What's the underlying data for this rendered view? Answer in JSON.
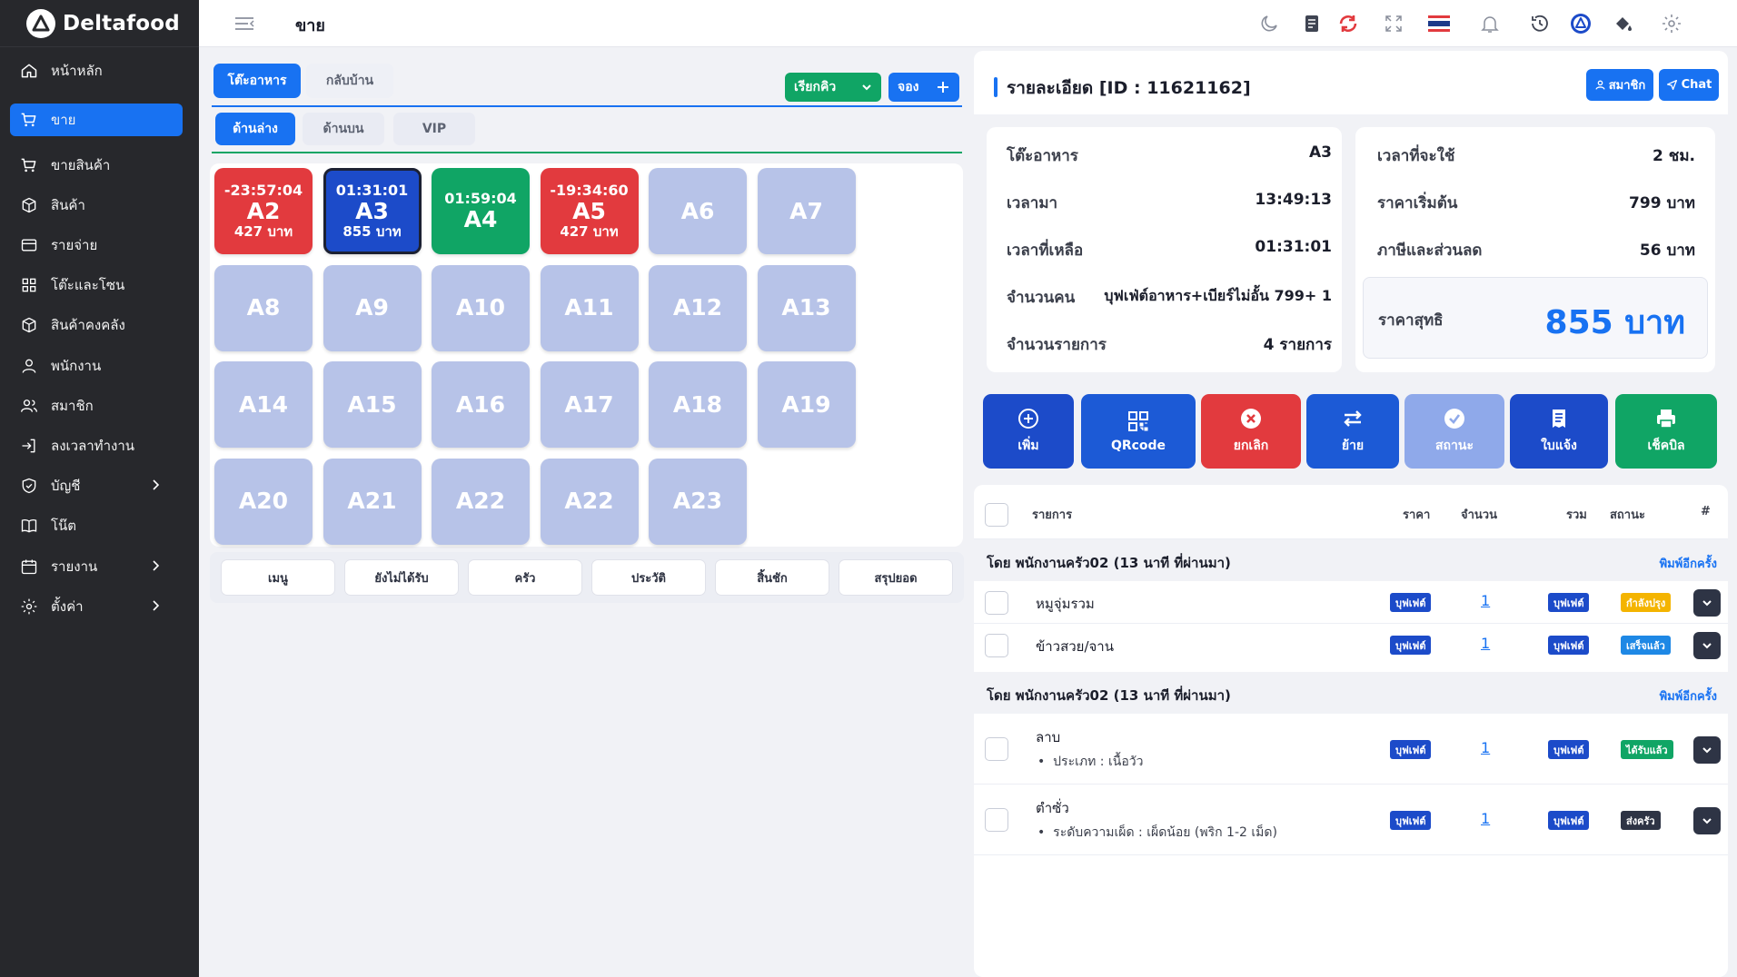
{
  "brand": {
    "name": "Deltafood"
  },
  "sidebar": {
    "items": [
      {
        "label": "หน้าหลัก",
        "icon": "home-icon"
      },
      {
        "label": "ขาย",
        "icon": "cart-icon",
        "active": true
      },
      {
        "label": "ขายสินค้า",
        "icon": "cart-icon"
      },
      {
        "label": "สินค้า",
        "icon": "box-icon"
      },
      {
        "label": "รายจ่าย",
        "icon": "card-icon"
      },
      {
        "label": "โต๊ะและโซน",
        "icon": "grid-icon"
      },
      {
        "label": "สินค้าคงคลัง",
        "icon": "box-icon"
      },
      {
        "label": "พนักงาน",
        "icon": "user-icon"
      },
      {
        "label": "สมาชิก",
        "icon": "users-icon"
      },
      {
        "label": "ลงเวลาทำงาน",
        "icon": "login-icon"
      },
      {
        "label": "บัญชี",
        "icon": "shield-icon",
        "submenu": true
      },
      {
        "label": "โน๊ต",
        "icon": "book-icon"
      },
      {
        "label": "รายงาน",
        "icon": "calendar-icon",
        "submenu": true
      },
      {
        "label": "ตั้งค่า",
        "icon": "gear-icon",
        "submenu": true
      }
    ]
  },
  "topbar": {
    "title": "ขาย"
  },
  "left": {
    "main_tabs": [
      {
        "label": "โต๊ะอาหาร",
        "active": true
      },
      {
        "label": "กลับบ้าน"
      }
    ],
    "queue_button": "เรียกคิว",
    "reserve_button": "จอง",
    "zone_tabs": [
      {
        "label": "ด้านล่าง",
        "active": true
      },
      {
        "label": "ด้านบน"
      },
      {
        "label": "VIP"
      }
    ],
    "tables": [
      {
        "name": "A2",
        "time": "-23:57:04",
        "price": "427 บาท",
        "status": "red"
      },
      {
        "name": "A3",
        "time": "01:31:01",
        "price": "855 บาท",
        "status": "blue"
      },
      {
        "name": "A4",
        "time": "01:59:04",
        "price": "",
        "status": "green"
      },
      {
        "name": "A5",
        "time": "-19:34:60",
        "price": "427 บาท",
        "status": "red"
      },
      {
        "name": "A6"
      },
      {
        "name": "A7"
      },
      {
        "name": "A8"
      },
      {
        "name": "A9"
      },
      {
        "name": "A10"
      },
      {
        "name": "A11"
      },
      {
        "name": "A12"
      },
      {
        "name": "A13"
      },
      {
        "name": "A14"
      },
      {
        "name": "A15"
      },
      {
        "name": "A16"
      },
      {
        "name": "A17"
      },
      {
        "name": "A18"
      },
      {
        "name": "A19"
      },
      {
        "name": "A20"
      },
      {
        "name": "A21"
      },
      {
        "name": "A22"
      },
      {
        "name": "A22"
      },
      {
        "name": "A23"
      }
    ],
    "bottom_tabs": [
      "เมนู",
      "ยังไม่ได้รับ",
      "ครัว",
      "ประวัติ",
      "สิ้นชัก",
      "สรุปยอด"
    ]
  },
  "detail": {
    "title": "รายละเอียด [ID : 11621162]",
    "member_button": "สมาชิก",
    "chat_button": "Chat",
    "info_left": [
      {
        "key": "โต๊ะอาหาร",
        "value": "A3"
      },
      {
        "key": "เวลามา",
        "value": "13:49:13"
      },
      {
        "key": "เวลาที่เหลือ",
        "value": "01:31:01"
      },
      {
        "key": "จำนวนคน",
        "value": "บุฟเฟ่ต์อาหาร+เบียร์ไม่อั้น 799+ 1"
      },
      {
        "key": "จำนวนรายการ",
        "value": "4 รายการ"
      }
    ],
    "info_right": [
      {
        "key": "เวลาที่จะใช้",
        "value": "2 ชม."
      },
      {
        "key": "ราคาเริ่มต้น",
        "value": "799 บาท"
      },
      {
        "key": "ภาษีและส่วนลด",
        "value": "56 บาท"
      }
    ],
    "net_label": "ราคาสุทธิ",
    "net_value": "855 บาท",
    "actions": [
      {
        "label": "เพิ่ม",
        "icon": "plus-circle-icon",
        "color": "#1c4bc9"
      },
      {
        "label": "QRcode",
        "icon": "qrcode-icon",
        "color": "#1c5ad6"
      },
      {
        "label": "ยกเลิก",
        "icon": "x-circle-icon",
        "color": "#e23a3e"
      },
      {
        "label": "ย้าย",
        "icon": "swap-icon",
        "color": "#1c5ad6"
      },
      {
        "label": "สถานะ",
        "icon": "check-circle-icon",
        "color": "#8fa9ea"
      },
      {
        "label": "ใบแจ้ง",
        "icon": "receipt-icon",
        "color": "#1c4bc9"
      },
      {
        "label": "เช็คบิล",
        "icon": "printer-icon",
        "color": "#10a565"
      }
    ],
    "list_headers": {
      "item": "รายการ",
      "price": "ราคา",
      "qty": "จำนวน",
      "total": "รวม",
      "status": "สถานะ",
      "hash": "#"
    },
    "groups": [
      {
        "title": "โดย พนักงานครัว02 (13 นาที ที่ผ่านมา)",
        "reprint": "พิมพ์อีกครั้ง",
        "rows": [
          {
            "name": "หมูจุ่มรวม",
            "detail": "",
            "price": "บุฟเฟต์",
            "qty": "1",
            "total": "บุฟเฟต์",
            "status": "กำลังปรุง",
            "status_color": "#f4b400"
          },
          {
            "name": "ข้าวสวย/จาน",
            "detail": "",
            "price": "บุฟเฟต์",
            "qty": "1",
            "total": "บุฟเฟต์",
            "status": "เสร็จแล้ว",
            "status_color": "#1e88e5"
          }
        ]
      },
      {
        "title": "โดย พนักงานครัว02 (13 นาที ที่ผ่านมา)",
        "reprint": "พิมพ์อีกครั้ง",
        "rows": [
          {
            "name": "ลาบ",
            "detail": "ประเภท : เนื้อวัว",
            "price": "บุฟเฟต์",
            "qty": "1",
            "total": "บุฟเฟต์",
            "status": "ได้รับแล้ว",
            "status_color": "#10a565"
          },
          {
            "name": "ตำซั่ว",
            "detail": "ระดับความเผ็ด : เผ็ดน้อย (พริก 1-2 เม็ด)",
            "price": "บุฟเฟต์",
            "qty": "1",
            "total": "บุฟเฟต์",
            "status": "ส่งครัว",
            "status_color": "#2e3445"
          }
        ]
      }
    ]
  }
}
